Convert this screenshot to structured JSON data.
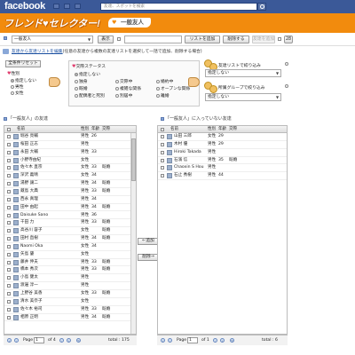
{
  "header": {
    "logo": "facebook",
    "search_placeholder": "友達、スポットを検索"
  },
  "banner": {
    "title": "フレンド♥セレクター!",
    "subtitle": "一般友人"
  },
  "toolbar": {
    "list_select": "一般友人",
    "show_button": "表示",
    "add_list_button": "リストを追加",
    "delete_button": "削除する",
    "disabled_button": "友達を追加",
    "count": "28"
  },
  "notice": {
    "link": "友達から友達リストを編集",
    "text": "(任意の友達から複数の友達リストを選択して一括で追加、削除する場合)"
  },
  "filters": {
    "reset_button": "全条件リセット",
    "gender_label": "性別",
    "gender_options": [
      {
        "label": "指定しない",
        "selected": true
      },
      {
        "label": "男性",
        "selected": false
      },
      {
        "label": "女性",
        "selected": false
      }
    ],
    "relationship_label": "交際ステータス",
    "relationship_options": [
      {
        "label": "指定しない",
        "selected": true
      },
      {
        "label": "独身",
        "selected": false
      },
      {
        "label": "交際中",
        "selected": false
      },
      {
        "label": "婚約中",
        "selected": false
      },
      {
        "label": "既婚",
        "selected": false
      },
      {
        "label": "複雑な関係",
        "selected": false
      },
      {
        "label": "オープンな関係",
        "selected": false
      },
      {
        "label": "配偶者と死別",
        "selected": false
      },
      {
        "label": "別居中",
        "selected": false
      },
      {
        "label": "離婚",
        "selected": false
      }
    ],
    "friend_list_label": "友達リストで絞り込み",
    "friend_list_value": "指定しない",
    "group_label": "所属グループで絞り込み",
    "group_value": "指定しない"
  },
  "left_panel": {
    "title": "「一般友人」の友達",
    "columns": {
      "name": "名前",
      "gender": "性別",
      "age": "年齢",
      "status": "交際"
    },
    "rows": [
      {
        "name": "堀谷 亮輔",
        "gender": "男性",
        "age": "26",
        "status": ""
      },
      {
        "name": "桜田 正志",
        "gender": "男性",
        "age": "",
        "status": ""
      },
      {
        "name": "永田 大輔",
        "gender": "男性",
        "age": "33",
        "status": ""
      },
      {
        "name": "小野寺由紀",
        "gender": "女性",
        "age": "",
        "status": ""
      },
      {
        "name": "佐々木 直宗",
        "gender": "女性",
        "age": "33",
        "status": "既婚"
      },
      {
        "name": "深沢 義晴",
        "gender": "女性",
        "age": "34",
        "status": ""
      },
      {
        "name": "湯野 譲二",
        "gender": "男性",
        "age": "34",
        "status": "既婚"
      },
      {
        "name": "蔵島 大典",
        "gender": "男性",
        "age": "33",
        "status": "既婚"
      },
      {
        "name": "西永 真理",
        "gender": "男性",
        "age": "34",
        "status": ""
      },
      {
        "name": "田中 由起",
        "gender": "男性",
        "age": "34",
        "status": "既婚"
      },
      {
        "name": "Daisuke Sano",
        "gender": "男性",
        "age": "36",
        "status": ""
      },
      {
        "name": "千田 力",
        "gender": "男性",
        "age": "33",
        "status": "既婚"
      },
      {
        "name": "高谷川 容子",
        "gender": "女性",
        "age": "",
        "status": "既婚"
      },
      {
        "name": "田村 直樹",
        "gender": "男性",
        "age": "34",
        "status": "既婚"
      },
      {
        "name": "Naomi Oka",
        "gender": "女性",
        "age": "34",
        "status": ""
      },
      {
        "name": "矢島 肇",
        "gender": "女性",
        "age": "",
        "status": ""
      },
      {
        "name": "藤井 伸夫",
        "gender": "男性",
        "age": "33",
        "status": "既婚"
      },
      {
        "name": "橋本 秀次",
        "gender": "男性",
        "age": "33",
        "status": "既婚"
      },
      {
        "name": "小島 健太",
        "gender": "男性",
        "age": "",
        "status": ""
      },
      {
        "name": "渡邊 淳一",
        "gender": "男性",
        "age": "",
        "status": ""
      },
      {
        "name": "上野谷 美香",
        "gender": "女性",
        "age": "33",
        "status": "既婚"
      },
      {
        "name": "清水 美奈子",
        "gender": "女性",
        "age": "",
        "status": ""
      },
      {
        "name": "佐々木 裕司",
        "gender": "男性",
        "age": "33",
        "status": "既婚"
      },
      {
        "name": "相原 正明",
        "gender": "男性",
        "age": "34",
        "status": "既婚"
      }
    ],
    "pager": {
      "page_label": "Page",
      "page": "1",
      "of_label": "of 4",
      "total": "total : 175"
    }
  },
  "right_panel": {
    "title": "「一般友人」に入っていない友達",
    "columns": {
      "name": "名前",
      "gender": "性別",
      "age": "年齢",
      "status": "交際"
    },
    "rows": [
      {
        "name": "山田 三郎",
        "gender": "女性",
        "age": "29",
        "status": ""
      },
      {
        "name": "木村 優",
        "gender": "男性",
        "age": "29",
        "status": ""
      },
      {
        "name": "Hiroki Takada",
        "gender": "男性",
        "age": "",
        "status": ""
      },
      {
        "name": "石濱 信",
        "gender": "男性",
        "age": "35",
        "status": "既婚"
      },
      {
        "name": "Chaoxin S Hou",
        "gender": "男性",
        "age": "",
        "status": ""
      },
      {
        "name": "石止 秀樹",
        "gender": "男性",
        "age": "44",
        "status": ""
      }
    ],
    "pager": {
      "page_label": "Page",
      "page": "1",
      "of_label": "of 1",
      "total": "total : 6"
    }
  },
  "move": {
    "add": "←追加",
    "remove": "削除→"
  }
}
